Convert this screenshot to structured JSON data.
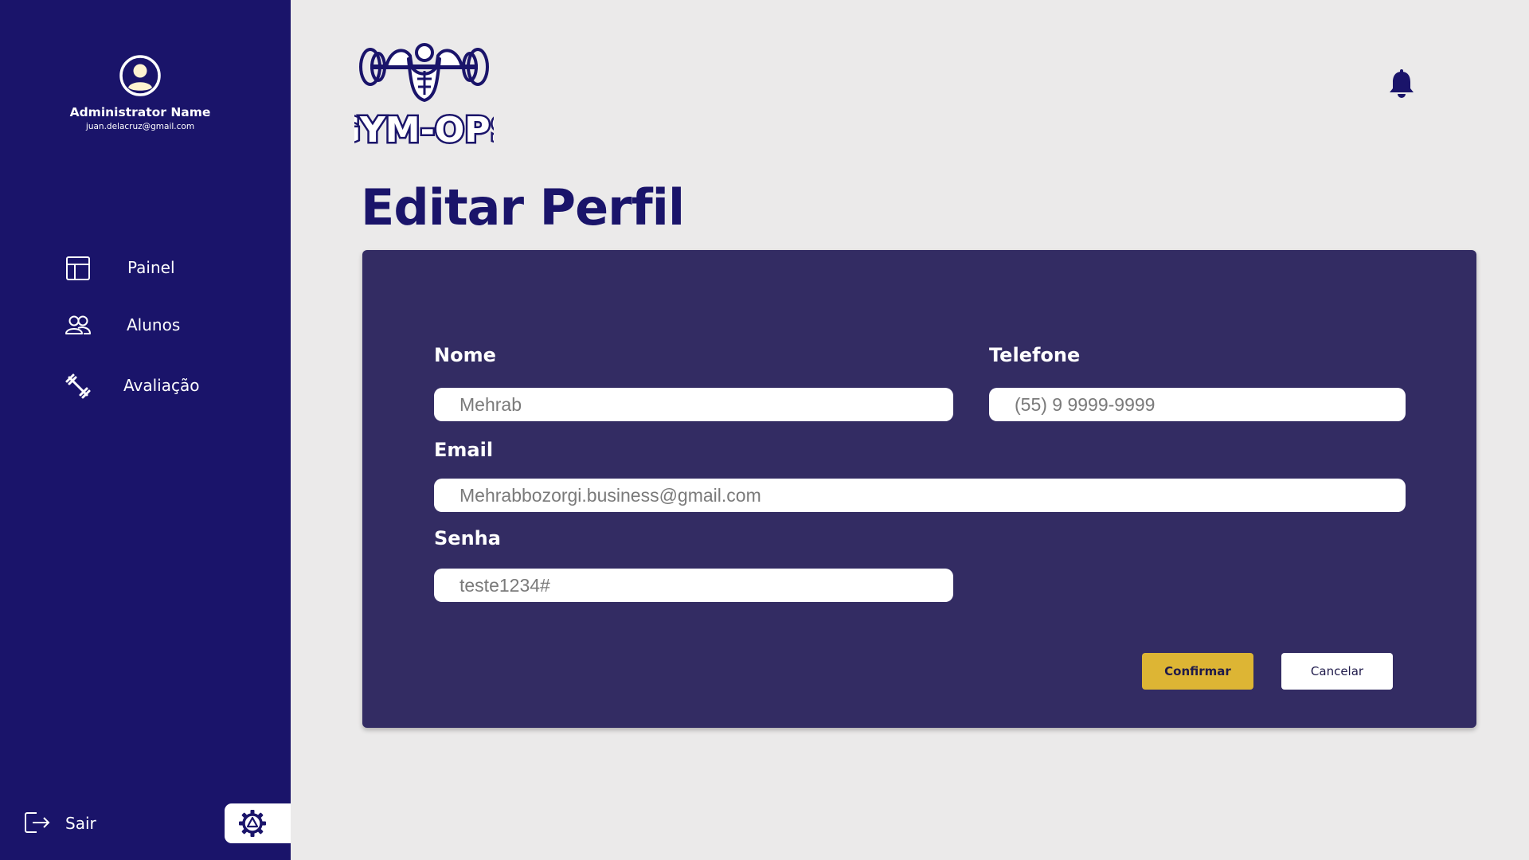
{
  "sidebar": {
    "admin_name": "Administrator Name",
    "admin_email": "juan.delacruz@gmail.com",
    "items": [
      {
        "label": "Painel",
        "icon": "layout-icon"
      },
      {
        "label": "Alunos",
        "icon": "users-icon"
      },
      {
        "label": "Avaliação",
        "icon": "dumbbell-icon"
      }
    ],
    "logout_label": "Sair"
  },
  "header": {
    "logo_text": "GYM-OPS"
  },
  "page": {
    "title": "Editar Perfil"
  },
  "form": {
    "nome_label": "Nome",
    "nome_value": "Mehrab",
    "telefone_label": "Telefone",
    "telefone_value": "(55) 9 9999-9999",
    "email_label": "Email",
    "email_value": "Mehrabbozorgi.business@gmail.com",
    "senha_label": "Senha",
    "senha_value": "teste1234#",
    "confirm_label": "Confirmar",
    "cancel_label": "Cancelar"
  },
  "colors": {
    "sidebar_bg": "#1a146a",
    "card_bg": "#332c63",
    "accent": "#ddb534",
    "page_bg": "#ebeaea"
  }
}
